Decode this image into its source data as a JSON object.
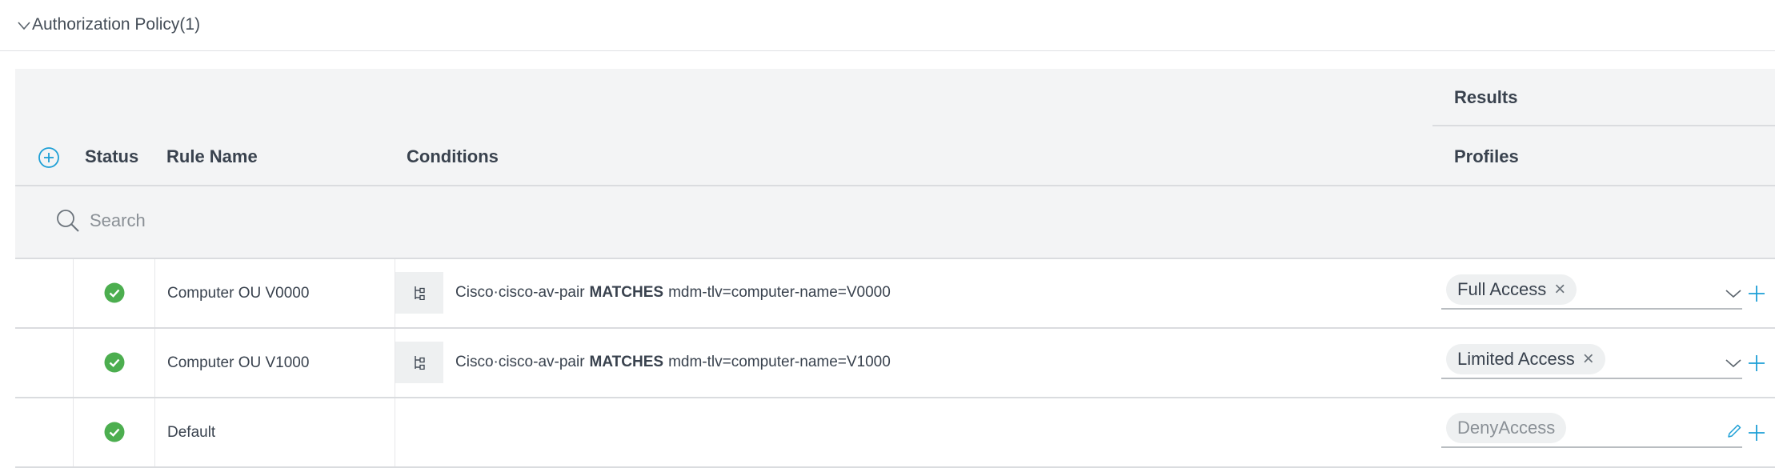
{
  "section": {
    "title": "Authorization Policy(1)"
  },
  "table": {
    "results_header": "Results",
    "columns": {
      "status": "Status",
      "rule_name": "Rule Name",
      "conditions": "Conditions",
      "profiles": "Profiles"
    },
    "search_placeholder": "Search"
  },
  "rules": [
    {
      "status": "enabled",
      "name": "Computer OU V0000",
      "condition": {
        "attribute": "Cisco·cisco-av-pair",
        "operator": "MATCHES",
        "value": "mdm-tlv=computer-name=V0000"
      },
      "profile": "Full Access",
      "profile_removable": true
    },
    {
      "status": "enabled",
      "name": "Computer OU V1000",
      "condition": {
        "attribute": "Cisco·cisco-av-pair",
        "operator": "MATCHES",
        "value": "mdm-tlv=computer-name=V1000"
      },
      "profile": "Limited Access",
      "profile_removable": true
    },
    {
      "status": "enabled",
      "name": "Default",
      "condition": null,
      "profile": "DenyAccess",
      "profile_removable": false
    }
  ],
  "colors": {
    "status_green": "#4cae4f",
    "accent_blue": "#1d9fd6"
  }
}
